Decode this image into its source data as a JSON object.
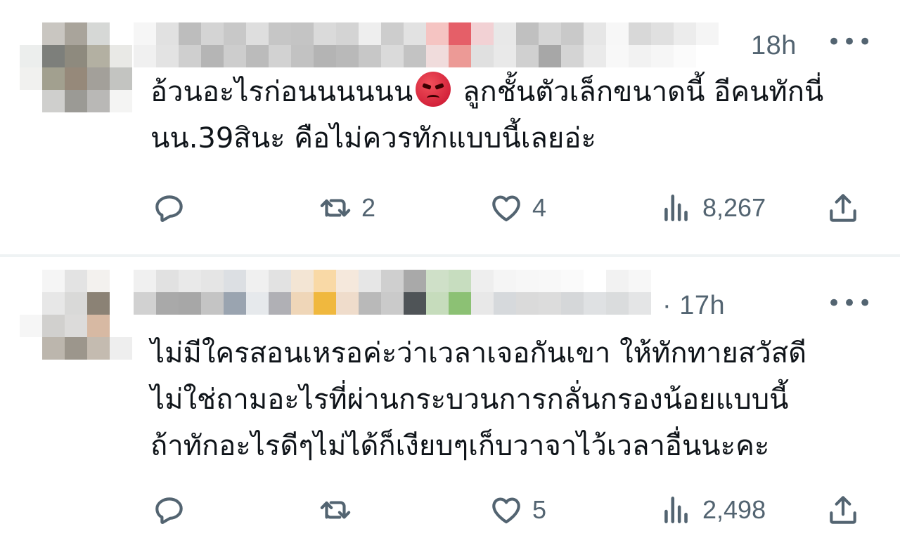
{
  "tweets": [
    {
      "time": "18h",
      "more": "•••",
      "lines": [
        "อ้วนอะไรก่อนนนนนน",
        "ลูกชั้นตัวเล็กขนาดนี้ อีคนทักนี่",
        "นน.39สินะ  คือไม่ควรทักแบบนี้เลยอ่ะ"
      ],
      "emoji": "angry-face-emoji",
      "reply_count": "",
      "retweet_count": "2",
      "like_count": "4",
      "view_count": "8,267"
    },
    {
      "time": "· 17h",
      "more": "•••",
      "lines": [
        "ไม่มีใครสอนเหรอค่ะว่าเวลาเจอกันเขา ให้ทักทายสวัสดี",
        "ไม่ใช่ถามอะไรที่ผ่านกระบวนการกลั่นกรองน้อยแบบนี้",
        "ถ้าทักอะไรดีๆไม่ได้ก็เงียบๆเก็บวาจาไว้เวลาอื่นนะคะ"
      ],
      "reply_count": "",
      "retweet_count": "",
      "like_count": "5",
      "view_count": "2,498"
    }
  ],
  "colors": {
    "text": "#0f1419",
    "muted": "#536471",
    "divider": "#eff3f4",
    "emoji_red": "#c8102e"
  },
  "icons": [
    "reply-icon",
    "retweet-icon",
    "like-icon",
    "views-icon",
    "share-icon",
    "more-icon"
  ]
}
